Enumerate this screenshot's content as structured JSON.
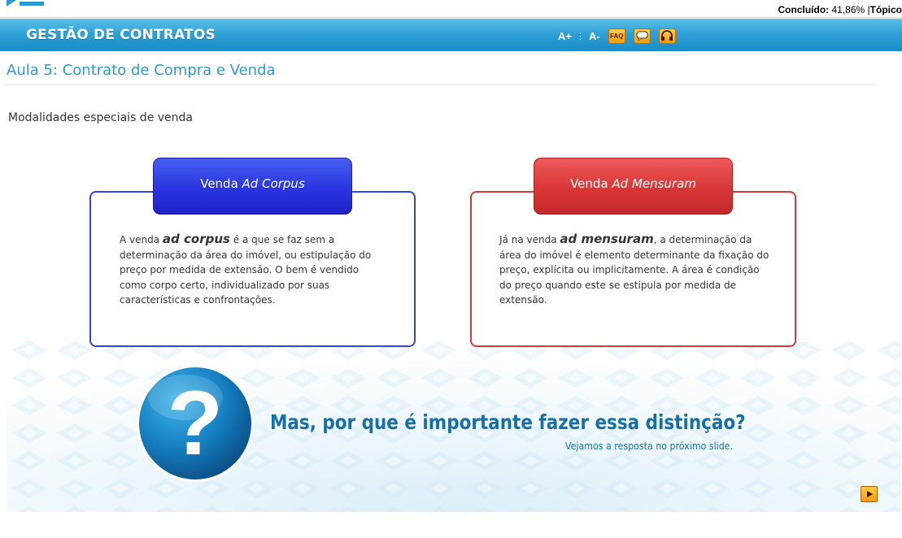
{
  "progress": {
    "label": "Concluído:",
    "value": "41,86%",
    "separator": "|",
    "topic": "Tópico"
  },
  "header": {
    "course_title": "GESTÃO DE CONTRATOS",
    "font_increase": "A+",
    "font_decrease": "A-",
    "faq_label": "FAQ",
    "icons": [
      "faq-icon",
      "chat-icon",
      "headphones-icon"
    ]
  },
  "lesson": {
    "title": "Aula 5: Contrato de Compra e Venda",
    "section_heading": "Modalidades especiais de venda"
  },
  "cards": [
    {
      "title_prefix": "Venda",
      "title_term": "Ad Corpus",
      "text_lead": "A venda",
      "text_term": "ad corpus",
      "text_rest": "é a que se faz sem a determinação da área do imóvel, ou estipulação do preço por medida de extensão. O bem é vendido como corpo certo, individualizado por suas características e confrontações.",
      "color": "#2a34e0"
    },
    {
      "title_prefix": "Venda",
      "title_term": "Ad Mensuram",
      "text_lead": "Já na venda",
      "text_term": "ad mensuram",
      "text_rest": ", a determinação da área do imóvel é elemento determinante da fixação do preço, explícita ou implicitamente.  A área é condição do preço quando este se estipula por medida de extensão.",
      "color": "#d93636"
    }
  ],
  "question": {
    "mark": "?",
    "text": "Mas, por que é importante fazer essa distinção?",
    "subtext": "Vejamos a resposta no próximo slide."
  },
  "colors": {
    "header_blue": "#2ea1d8",
    "title_blue": "#2a9ad0",
    "question_blue": "#1670a8",
    "accent_orange": "#f39a10"
  }
}
